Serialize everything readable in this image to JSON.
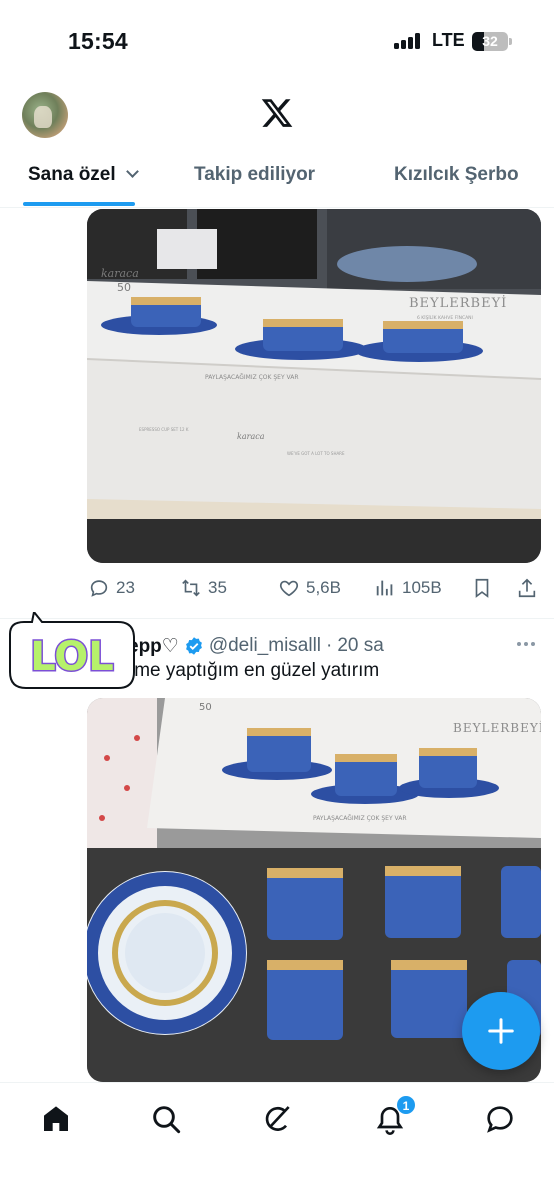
{
  "status_bar": {
    "time": "15:54",
    "network": "LTE",
    "battery_level": "32",
    "battery_fraction": 0.32
  },
  "header": {
    "avatar_icon": "profile-avatar",
    "logo_icon": "x-logo-icon"
  },
  "tabs": [
    {
      "label": "Sana özel",
      "active": true
    },
    {
      "label": "Takip ediliyor",
      "active": false
    },
    {
      "label": "Kızılcık Şerbo",
      "active": false
    }
  ],
  "post1": {
    "image_description_icon": "photo",
    "image_text": {
      "brand": "karaca",
      "brand_sub": "50",
      "product": "BEYLERBEYİ",
      "product_sub": "6 KİŞİLİK KAHVE FİNCANI",
      "slogan": "PAYLAŞACAĞIMIZ ÇOK ŞEY VAR",
      "small_left": "ESPRESSO CUP SET 12 K",
      "small_right": "WE'VE GOT A LOT TO SHARE"
    },
    "actions": {
      "replies": "23",
      "reposts": "35",
      "likes": "5,6B",
      "views": "105B"
    }
  },
  "post2": {
    "display_name": "epp♡",
    "handle": "@deli_misalll",
    "separator": "·",
    "time": "20 sa",
    "text": "ime yaptığım en güzel yatırım",
    "sticker_text": "LOL",
    "image_text": {
      "brand_sub": "50",
      "product": "BEYLERBEYİ",
      "slogan": "PAYLAŞACAĞIMIZ ÇOK ŞEY VAR"
    }
  },
  "fab": {
    "icon": "plus-icon"
  },
  "bottom_nav": {
    "items": [
      "home-icon",
      "search-icon",
      "grok-icon",
      "bell-icon",
      "messages-icon"
    ],
    "notification_count": "1"
  },
  "colors": {
    "accent": "#1d9bf0",
    "text_primary": "#0f1419",
    "text_secondary": "#536471",
    "lol_green": "#b6f16b",
    "lol_purple": "#7b4fd6"
  }
}
